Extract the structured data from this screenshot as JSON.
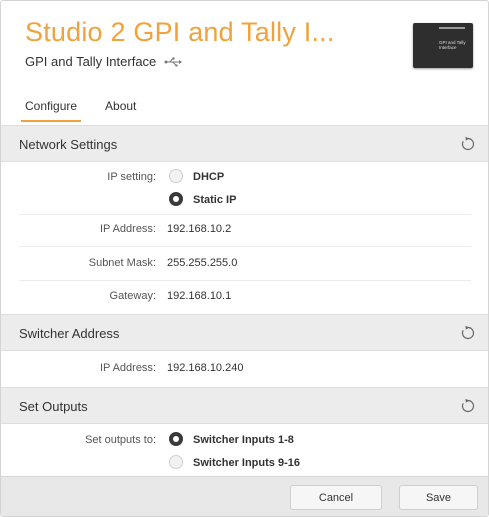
{
  "header": {
    "title": "Studio 2 GPI and Tally I...",
    "subtitle": "GPI and Tally Interface",
    "connection_icon": "usb-icon",
    "device_label": "GPI and Tally Interface"
  },
  "tabs": [
    {
      "label": "Configure",
      "active": true
    },
    {
      "label": "About",
      "active": false
    }
  ],
  "network": {
    "heading": "Network Settings",
    "ip_setting_label": "IP setting:",
    "options": [
      {
        "label": "DHCP",
        "selected": false
      },
      {
        "label": "Static IP",
        "selected": true
      }
    ],
    "ip_address_label": "IP Address:",
    "ip_address": "192.168.10.2",
    "subnet_label": "Subnet Mask:",
    "subnet": "255.255.255.0",
    "gateway_label": "Gateway:",
    "gateway": "192.168.10.1"
  },
  "switcher": {
    "heading": "Switcher Address",
    "ip_address_label": "IP Address:",
    "ip_address": "192.168.10.240"
  },
  "outputs": {
    "heading": "Set Outputs",
    "label": "Set outputs to:",
    "options": [
      {
        "label": "Switcher Inputs 1-8",
        "selected": true
      },
      {
        "label": "Switcher Inputs 9-16",
        "selected": false
      }
    ]
  },
  "footer": {
    "cancel": "Cancel",
    "save": "Save"
  },
  "colors": {
    "accent": "#f0a23c",
    "section_bg": "#ececec"
  }
}
